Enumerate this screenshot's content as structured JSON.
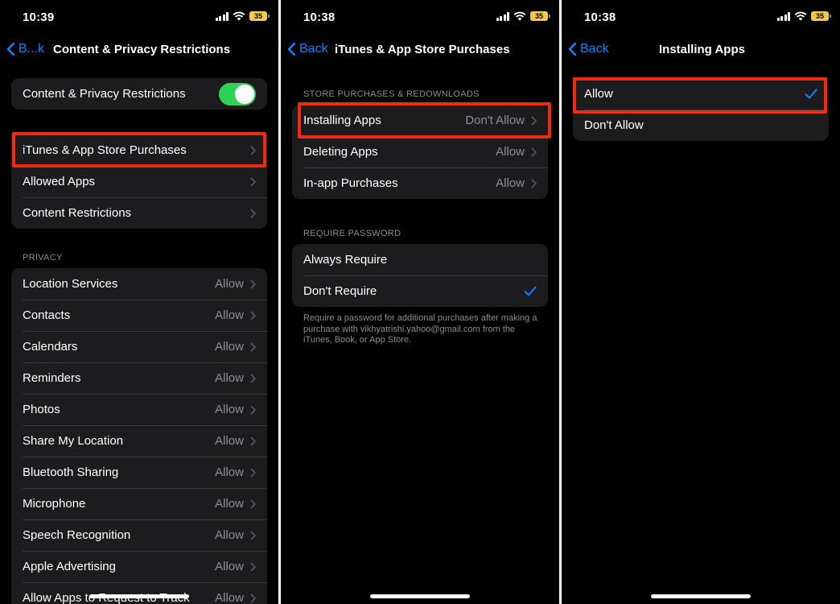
{
  "panels": [
    {
      "status_time": "10:39",
      "battery": "35",
      "back_label": "B...k",
      "title": "Content & Privacy Restrictions",
      "toggle_row": {
        "label": "Content & Privacy Restrictions",
        "on": true
      },
      "menu_items": [
        {
          "label": "iTunes & App Store Purchases"
        },
        {
          "label": "Allowed Apps"
        },
        {
          "label": "Content Restrictions"
        }
      ],
      "privacy_header": "PRIVACY",
      "privacy_items": [
        {
          "label": "Location Services",
          "value": "Allow"
        },
        {
          "label": "Contacts",
          "value": "Allow"
        },
        {
          "label": "Calendars",
          "value": "Allow"
        },
        {
          "label": "Reminders",
          "value": "Allow"
        },
        {
          "label": "Photos",
          "value": "Allow"
        },
        {
          "label": "Share My Location",
          "value": "Allow"
        },
        {
          "label": "Bluetooth Sharing",
          "value": "Allow"
        },
        {
          "label": "Microphone",
          "value": "Allow"
        },
        {
          "label": "Speech Recognition",
          "value": "Allow"
        },
        {
          "label": "Apple Advertising",
          "value": "Allow"
        },
        {
          "label": "Allow Apps to Request to Track",
          "value": "Allow"
        }
      ]
    },
    {
      "status_time": "10:38",
      "battery": "35",
      "back_label": "Back",
      "title": "iTunes & App Store Purchases",
      "store_header": "STORE PURCHASES & REDOWNLOADS",
      "store_items": [
        {
          "label": "Installing Apps",
          "value": "Don't Allow"
        },
        {
          "label": "Deleting Apps",
          "value": "Allow"
        },
        {
          "label": "In-app Purchases",
          "value": "Allow"
        }
      ],
      "password_header": "REQUIRE PASSWORD",
      "password_items": [
        {
          "label": "Always Require",
          "selected": false
        },
        {
          "label": "Don't Require",
          "selected": true
        }
      ],
      "password_footnote": "Require a password for additional purchases after making a purchase with vikhyatrishi.yahoo@gmail.com from the iTunes, Book, or App Store."
    },
    {
      "status_time": "10:38",
      "battery": "35",
      "back_label": "Back",
      "title": "Installing Apps",
      "options": [
        {
          "label": "Allow",
          "selected": true
        },
        {
          "label": "Don't Allow",
          "selected": false
        }
      ]
    }
  ],
  "colors": {
    "accent": "#0a84ff",
    "highlight": "#f22a10",
    "toggle_on": "#30d158",
    "cell_bg": "#1c1c1e",
    "secondary_text": "#8e8e93"
  }
}
